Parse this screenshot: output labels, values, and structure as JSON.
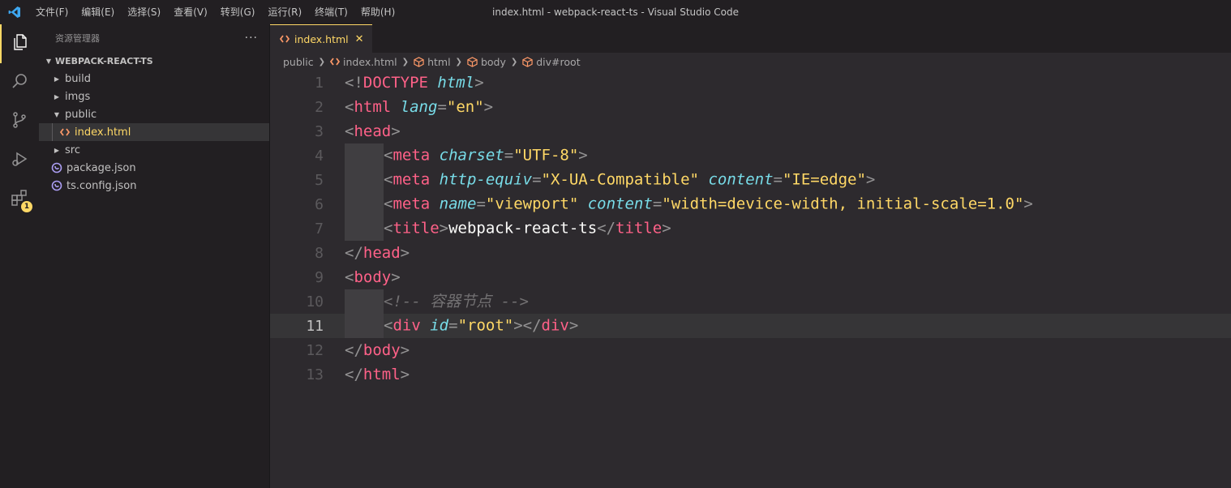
{
  "titlebar": {
    "menu": [
      "文件(F)",
      "编辑(E)",
      "选择(S)",
      "查看(V)",
      "转到(G)",
      "运行(R)",
      "终端(T)",
      "帮助(H)"
    ],
    "window_title": "index.html - webpack-react-ts - Visual Studio Code"
  },
  "activity_bar": {
    "extensions_badge": "1"
  },
  "sidebar": {
    "title": "资源管理器",
    "more": "···",
    "project": "WEBPACK-REACT-TS",
    "items": [
      {
        "label": "build",
        "type": "folder",
        "expanded": false
      },
      {
        "label": "imgs",
        "type": "folder",
        "expanded": false
      },
      {
        "label": "public",
        "type": "folder",
        "expanded": true
      },
      {
        "label": "index.html",
        "type": "html-file",
        "selected": true
      },
      {
        "label": "src",
        "type": "folder",
        "expanded": false
      },
      {
        "label": "package.json",
        "type": "json-file"
      },
      {
        "label": "ts.config.json",
        "type": "json-file"
      }
    ]
  },
  "editor": {
    "tab": {
      "label": "index.html",
      "close": "✕"
    },
    "breadcrumb": [
      "public",
      "index.html",
      "html",
      "body",
      "div#root"
    ],
    "current_line": 11,
    "lines": [
      {
        "n": "1"
      },
      {
        "n": "2"
      },
      {
        "n": "3"
      },
      {
        "n": "4"
      },
      {
        "n": "5"
      },
      {
        "n": "6"
      },
      {
        "n": "7"
      },
      {
        "n": "8"
      },
      {
        "n": "9"
      },
      {
        "n": "10"
      },
      {
        "n": "11"
      },
      {
        "n": "12"
      },
      {
        "n": "13"
      }
    ],
    "code": {
      "l1": [
        "<!",
        "DOCTYPE",
        " ",
        "html",
        ">"
      ],
      "l2": [
        "<",
        "html",
        " ",
        "lang",
        "=",
        "\"en\"",
        ">"
      ],
      "l3": [
        "<",
        "head",
        ">"
      ],
      "l4": [
        "<",
        "meta",
        " ",
        "charset",
        "=",
        "\"UTF-8\"",
        ">"
      ],
      "l5": [
        "<",
        "meta",
        " ",
        "http-equiv",
        "=",
        "\"X-UA-Compatible\"",
        " ",
        "content",
        "=",
        "\"IE=edge\"",
        ">"
      ],
      "l6": [
        "<",
        "meta",
        " ",
        "name",
        "=",
        "\"viewport\"",
        " ",
        "content",
        "=",
        "\"width=device-width, initial-scale=1.0\"",
        ">"
      ],
      "l7": [
        "<",
        "title",
        ">",
        "webpack-react-ts",
        "</",
        "title",
        ">"
      ],
      "l8": [
        "</",
        "head",
        ">"
      ],
      "l9": [
        "<",
        "body",
        ">"
      ],
      "l10": [
        "<!-- 容器节点 -->"
      ],
      "l11": [
        "<",
        "div",
        " ",
        "id",
        "=",
        "\"root\"",
        "></",
        "div",
        ">"
      ],
      "l12": [
        "</",
        "body",
        ">"
      ],
      "l13": [
        "</",
        "html",
        ">"
      ]
    }
  },
  "colors": {
    "background": "#2d2a2e",
    "sidebar": "#221f22",
    "accent": "#ffd866",
    "tag": "#ff6188",
    "attribute": "#78dce8",
    "string": "#ffd866",
    "comment": "#727072"
  }
}
